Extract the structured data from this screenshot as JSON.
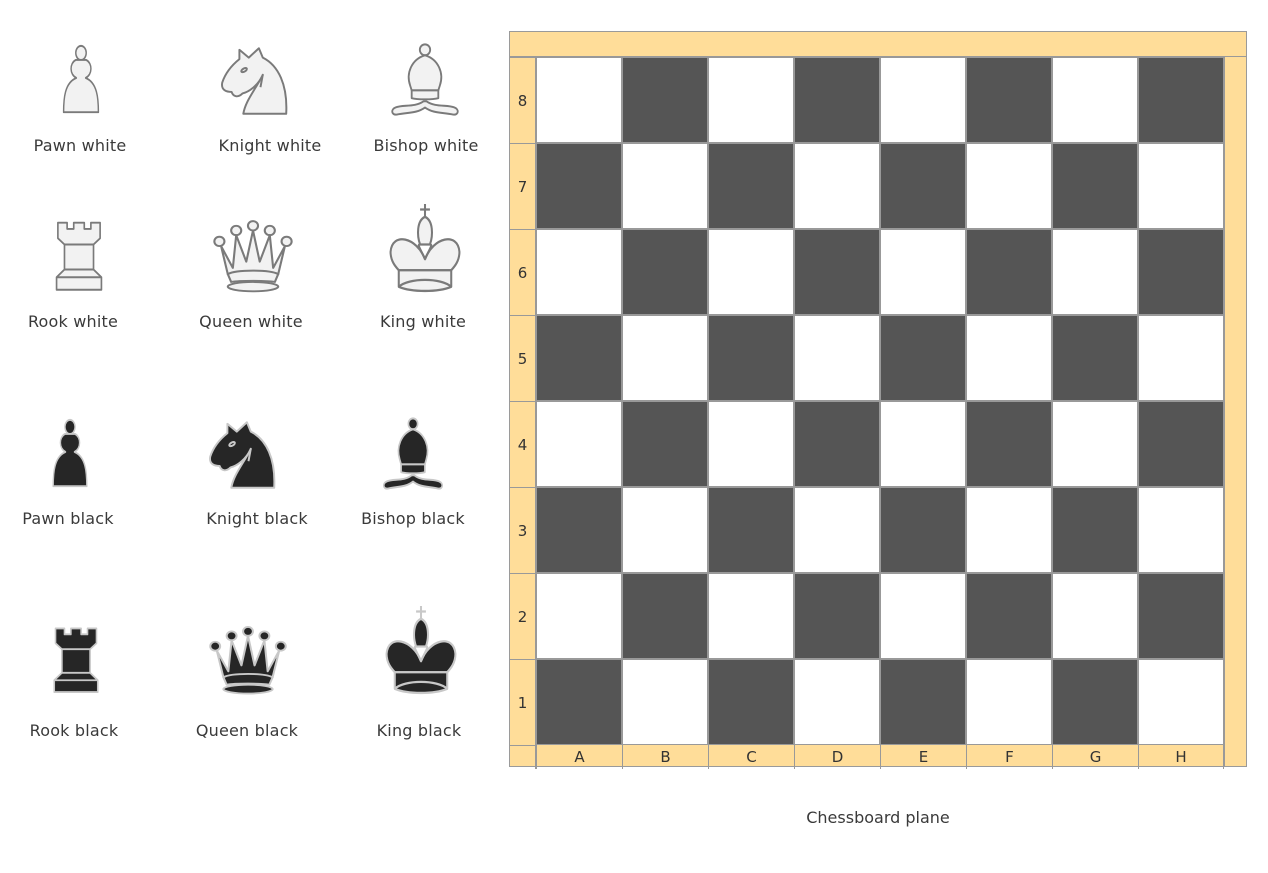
{
  "pieces": [
    {
      "id": "pawn-white",
      "label": "Pawn white",
      "type": "pawn",
      "color": "white"
    },
    {
      "id": "knight-white",
      "label": "Knight white",
      "type": "knight",
      "color": "white"
    },
    {
      "id": "bishop-white",
      "label": "Bishop white",
      "type": "bishop",
      "color": "white"
    },
    {
      "id": "rook-white",
      "label": "Rook white",
      "type": "rook",
      "color": "white"
    },
    {
      "id": "queen-white",
      "label": "Queen white",
      "type": "queen",
      "color": "white"
    },
    {
      "id": "king-white",
      "label": "King white",
      "type": "king",
      "color": "white"
    },
    {
      "id": "pawn-black",
      "label": "Pawn black",
      "type": "pawn",
      "color": "black"
    },
    {
      "id": "knight-black",
      "label": "Knight black",
      "type": "knight",
      "color": "black"
    },
    {
      "id": "bishop-black",
      "label": "Bishop black",
      "type": "bishop",
      "color": "black"
    },
    {
      "id": "rook-black",
      "label": "Rook black",
      "type": "rook",
      "color": "black"
    },
    {
      "id": "queen-black",
      "label": "Queen black",
      "type": "queen",
      "color": "black"
    },
    {
      "id": "king-black",
      "label": "King black",
      "type": "king",
      "color": "black"
    }
  ],
  "board": {
    "files": [
      "A",
      "B",
      "C",
      "D",
      "E",
      "F",
      "G",
      "H"
    ],
    "ranks": [
      "8",
      "7",
      "6",
      "5",
      "4",
      "3",
      "2",
      "1"
    ],
    "colors": {
      "frame": "#ffdd99",
      "dark": "#555555",
      "light": "#ffffff",
      "border": "#999999"
    },
    "caption": "Chessboard plane"
  },
  "piece_colors": {
    "white": {
      "fill": "#f2f2f2",
      "stroke": "#7a7a7a"
    },
    "black": {
      "fill": "#262626",
      "stroke": "#c8c8c8"
    }
  }
}
